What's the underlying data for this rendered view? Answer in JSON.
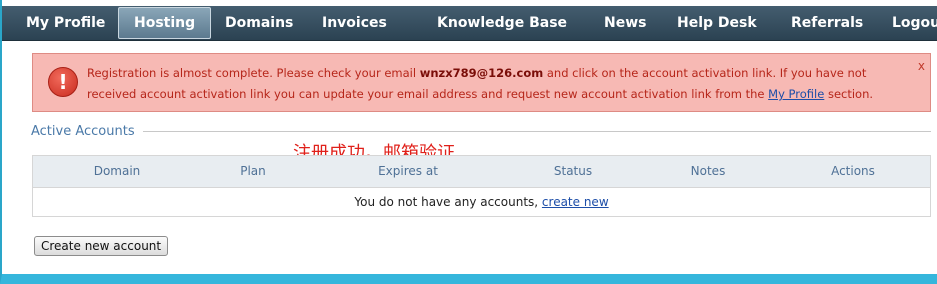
{
  "nav": {
    "items": [
      {
        "label": "My Profile"
      },
      {
        "label": "Hosting",
        "active": true
      },
      {
        "label": "Domains"
      },
      {
        "label": "Invoices"
      },
      {
        "label": "Knowledge Base"
      },
      {
        "label": "News"
      },
      {
        "label": "Help Desk"
      },
      {
        "label": "Referrals"
      },
      {
        "label": "Logout"
      }
    ]
  },
  "alert": {
    "icon": "exclamation-icon",
    "text_before": "Registration is almost complete. Please check your email ",
    "email": "wnzx789@126.com",
    "text_middle": " and click on the account activation link. If you have not received account activation link you can update your email address and request new account activation link from the ",
    "profile_link": "My Profile",
    "text_after": " section.",
    "close": "x"
  },
  "accounts": {
    "title": "Active Accounts",
    "columns": [
      "Domain",
      "Plan",
      "Expires at",
      "Status",
      "Notes",
      "Actions"
    ],
    "empty_text": "You do not have any accounts, ",
    "create_link": "create new"
  },
  "annotation": "注册成功。邮箱验证",
  "create_button": "Create new account",
  "colors": {
    "nav_bg": "#2b4252",
    "alert_bg": "#f7b9b4",
    "alert_text": "#b6261a",
    "accent": "#4a79a8",
    "annotation": "#e0201a"
  }
}
